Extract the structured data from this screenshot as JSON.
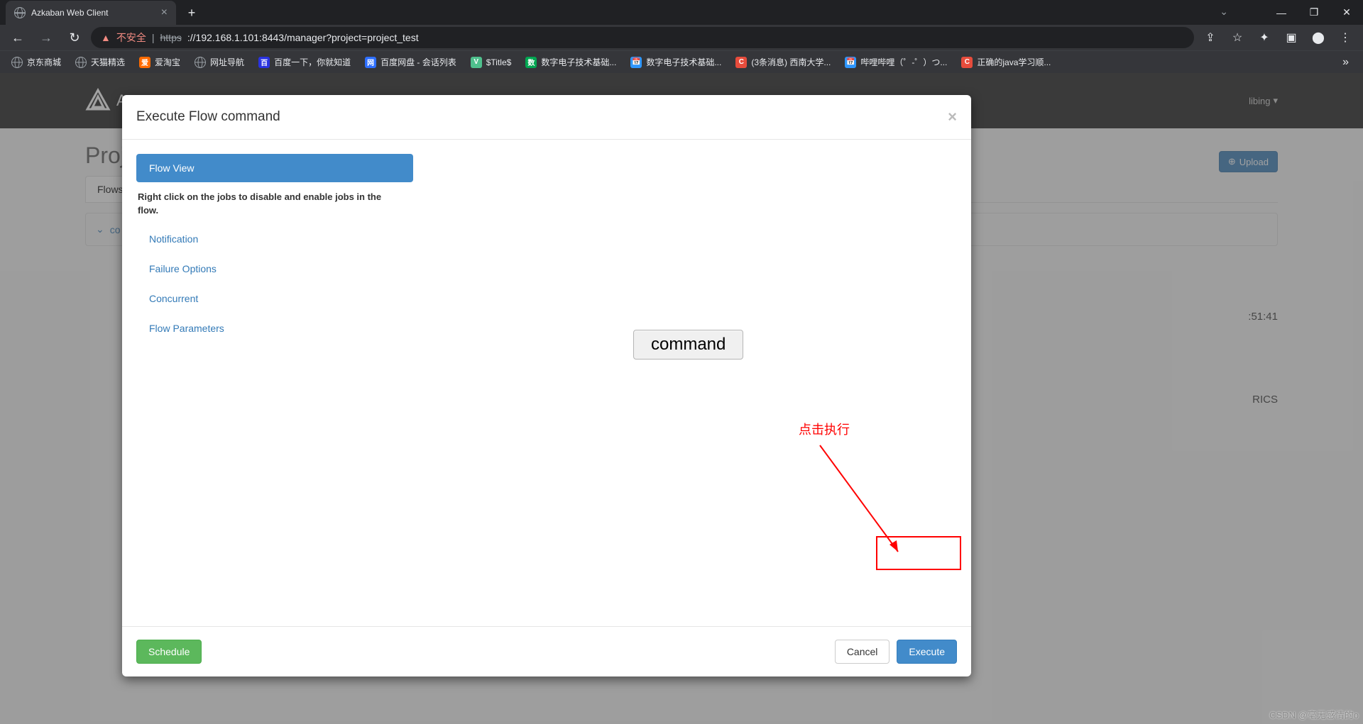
{
  "browser": {
    "tab_title": "Azkaban Web Client",
    "new_tab": "+",
    "window": {
      "min": "—",
      "max": "❐",
      "close": "✕"
    },
    "nav": {
      "back": "←",
      "forward": "→",
      "reload": "↻"
    },
    "insecure_label": "不安全",
    "url_scheme": "https",
    "url_rest": "://192.168.1.101:8443/manager?project=project_test",
    "right_icons": {
      "share": "⇪",
      "star": "☆",
      "ext": "✦",
      "side": "▣",
      "profile": "⬤",
      "menu": "⋮"
    }
  },
  "bookmarks": [
    {
      "icon": "g",
      "label": "京东商城",
      "bg": ""
    },
    {
      "icon": "g",
      "label": "天猫精选",
      "bg": ""
    },
    {
      "icon": "爱",
      "label": "爱淘宝",
      "bg": "#ff6a00",
      "col": "#fff"
    },
    {
      "icon": "g",
      "label": "网址导航",
      "bg": ""
    },
    {
      "icon": "百",
      "label": "百度一下，你就知道",
      "bg": "#2932e1",
      "col": "#fff"
    },
    {
      "icon": "网",
      "label": "百度网盘 - 会话列表",
      "bg": "#2e6fff",
      "col": "#fff"
    },
    {
      "icon": "V",
      "label": "$Title$",
      "bg": "#4fc08d",
      "col": "#fff"
    },
    {
      "icon": "数",
      "label": "数字电子技术基础...",
      "bg": "#00a651",
      "col": "#fff"
    },
    {
      "icon": "📅",
      "label": "数字电子技术基础...",
      "bg": "#2e97ff",
      "col": "#fff"
    },
    {
      "icon": "C",
      "label": "(3条消息) 西南大学...",
      "bg": "#e74c3c",
      "col": "#fff"
    },
    {
      "icon": "📅",
      "label": "哔哩哔哩（゜-゜）つ...",
      "bg": "#2e97ff",
      "col": "#fff"
    },
    {
      "icon": "C",
      "label": "正确的java学习顺...",
      "bg": "#e74c3c",
      "col": "#fff"
    }
  ],
  "page": {
    "app_name": "A",
    "project_prefix": "Projec",
    "user": "libing",
    "upload": "Upload",
    "tab_flows": "Flows",
    "flow_cmd_prefix": "co",
    "time_partial": ":51:41",
    "rics_partial": "RICS"
  },
  "modal": {
    "title": "Execute Flow command",
    "close": "×",
    "sidebar": {
      "flow_view": "Flow View",
      "desc": "Right click on the jobs to disable and enable jobs in the flow.",
      "notification": "Notification",
      "failure": "Failure Options",
      "concurrent": "Concurrent",
      "params": "Flow Parameters"
    },
    "job_node": "command",
    "footer": {
      "schedule": "Schedule",
      "cancel": "Cancel",
      "execute": "Execute"
    }
  },
  "annotation": {
    "label": "点击执行"
  },
  "watermark": "CSDN @毫无感情的o"
}
